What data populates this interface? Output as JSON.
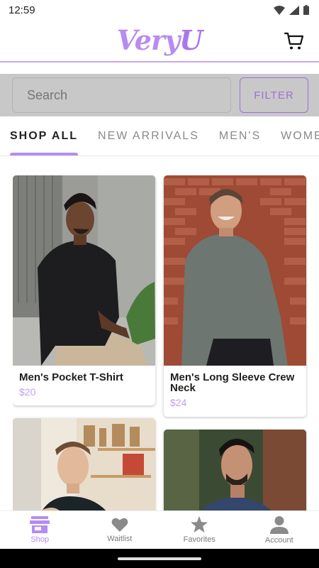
{
  "status_bar": {
    "time": "12:59"
  },
  "header": {
    "logo_part1": "Very",
    "logo_part2": "U"
  },
  "search": {
    "placeholder": "Search",
    "filter_label": "FILTER"
  },
  "tabs": [
    "SHOP ALL",
    "NEW ARRIVALS",
    "MEN'S",
    "WOMEN'S"
  ],
  "products": [
    {
      "name": "Men's Pocket T-Shirt",
      "price": "$20"
    },
    {
      "name": "Men's Long Sleeve Crew Neck",
      "price": "$24"
    },
    {
      "name": "",
      "price": ""
    },
    {
      "name": "",
      "price": ""
    }
  ],
  "bottom_nav": [
    {
      "label": "Shop",
      "icon": "store-icon",
      "active": true
    },
    {
      "label": "Waitlist",
      "icon": "heart-icon",
      "active": false
    },
    {
      "label": "Favorites",
      "icon": "star-icon",
      "active": false
    },
    {
      "label": "Account",
      "icon": "account-icon",
      "active": false
    }
  ],
  "colors": {
    "accent": "#b78cf0",
    "search_band": "#c8c8c8",
    "price": "#c49cf2"
  }
}
